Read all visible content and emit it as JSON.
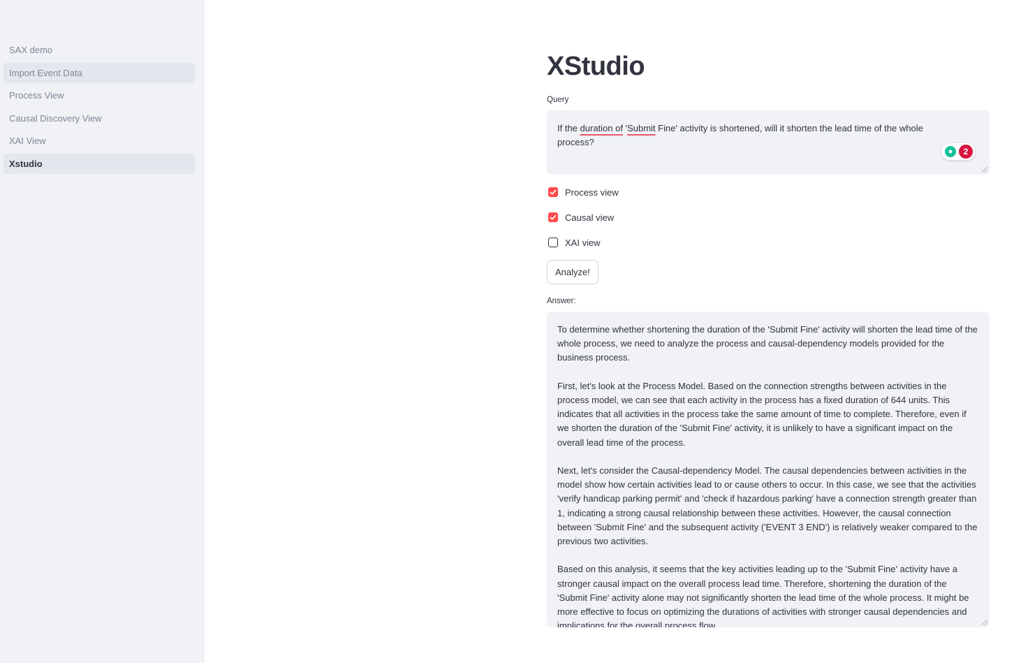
{
  "sidebar": {
    "items": [
      {
        "label": "SAX demo"
      },
      {
        "label": "Import Event Data"
      },
      {
        "label": "Process View"
      },
      {
        "label": "Causal Discovery View"
      },
      {
        "label": "XAI View"
      },
      {
        "label": "Xstudio"
      }
    ]
  },
  "main": {
    "title": "XStudio",
    "query": {
      "label": "Query",
      "before": "If the ",
      "spell1": "duration  of",
      "mid": " '",
      "spell2": "Submit",
      "after": " Fine' activity is shortened, will it shorten the lead time of the whole process?",
      "grammarly_count": "2"
    },
    "checkboxes": {
      "process": {
        "label": "Process view",
        "checked": true
      },
      "causal": {
        "label": "Causal view",
        "checked": true
      },
      "xai": {
        "label": "XAI view",
        "checked": false
      }
    },
    "analyze_label": "Analyze!",
    "answer": {
      "label": "Answer:",
      "paragraphs": [
        "To determine whether shortening the duration of the 'Submit Fine' activity will shorten the lead time of the whole process, we need to analyze the process and causal-dependency models provided for the business process.",
        "First, let's look at the Process Model. Based on the connection strengths between activities in the process model, we can see that each activity in the process has a fixed duration of 644 units. This indicates that all activities in the process take the same amount of time to complete. Therefore, even if we shorten the duration of the 'Submit Fine' activity, it is unlikely to have a significant impact on the overall lead time of the process.",
        "Next, let's consider the Causal-dependency Model. The causal dependencies between activities in the model show how certain activities lead to or cause others to occur. In this case, we see that the activities 'verify handicap parking permit' and 'check if hazardous parking' have a connection strength greater than 1, indicating a strong causal relationship between these activities. However, the causal connection between 'Submit Fine' and the subsequent activity ('EVENT 3 END') is relatively weaker compared to the previous two activities.",
        "Based on this analysis, it seems that the key activities leading up to the 'Submit Fine' activity have a stronger causal impact on the overall process lead time. Therefore, shortening the duration of the 'Submit Fine' activity alone may not significantly shorten the lead time of the whole process. It might be more effective to focus on optimizing the durations of activities with stronger causal dependencies and implications for the overall process flow."
      ]
    }
  },
  "colors": {
    "sidebar_bg": "#f0f2f6",
    "accent": "#ff4b4b",
    "text": "#31333f",
    "muted_text": "#808495"
  }
}
